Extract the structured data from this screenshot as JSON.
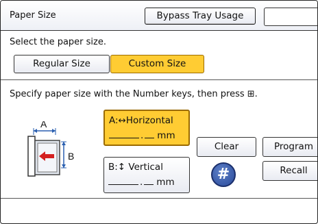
{
  "header": {
    "title": "Paper Size",
    "bypass_button": "Bypass Tray Usage"
  },
  "paper_selection": {
    "prompt": "Select the paper size.",
    "regular_label": "Regular Size",
    "custom_label": "Custom Size",
    "selected": "Custom Size"
  },
  "instruction": "Specify paper size with the Number keys, then press ⊞.",
  "dimensions": {
    "a": {
      "prefix": "A:↔",
      "label": "Horizontal",
      "unit": "mm"
    },
    "b": {
      "prefix": "B:↕",
      "label": "Vertical",
      "unit": "mm"
    }
  },
  "diagram": {
    "label_a": "A",
    "label_b": "B"
  },
  "actions": {
    "clear": "Clear",
    "program": "Program",
    "recall": "Recall",
    "hash_symbol": "#"
  },
  "colors": {
    "selected_bg": "#ffcc33",
    "hash_key": "#2a4b9b",
    "arrow_red": "#d42020"
  }
}
